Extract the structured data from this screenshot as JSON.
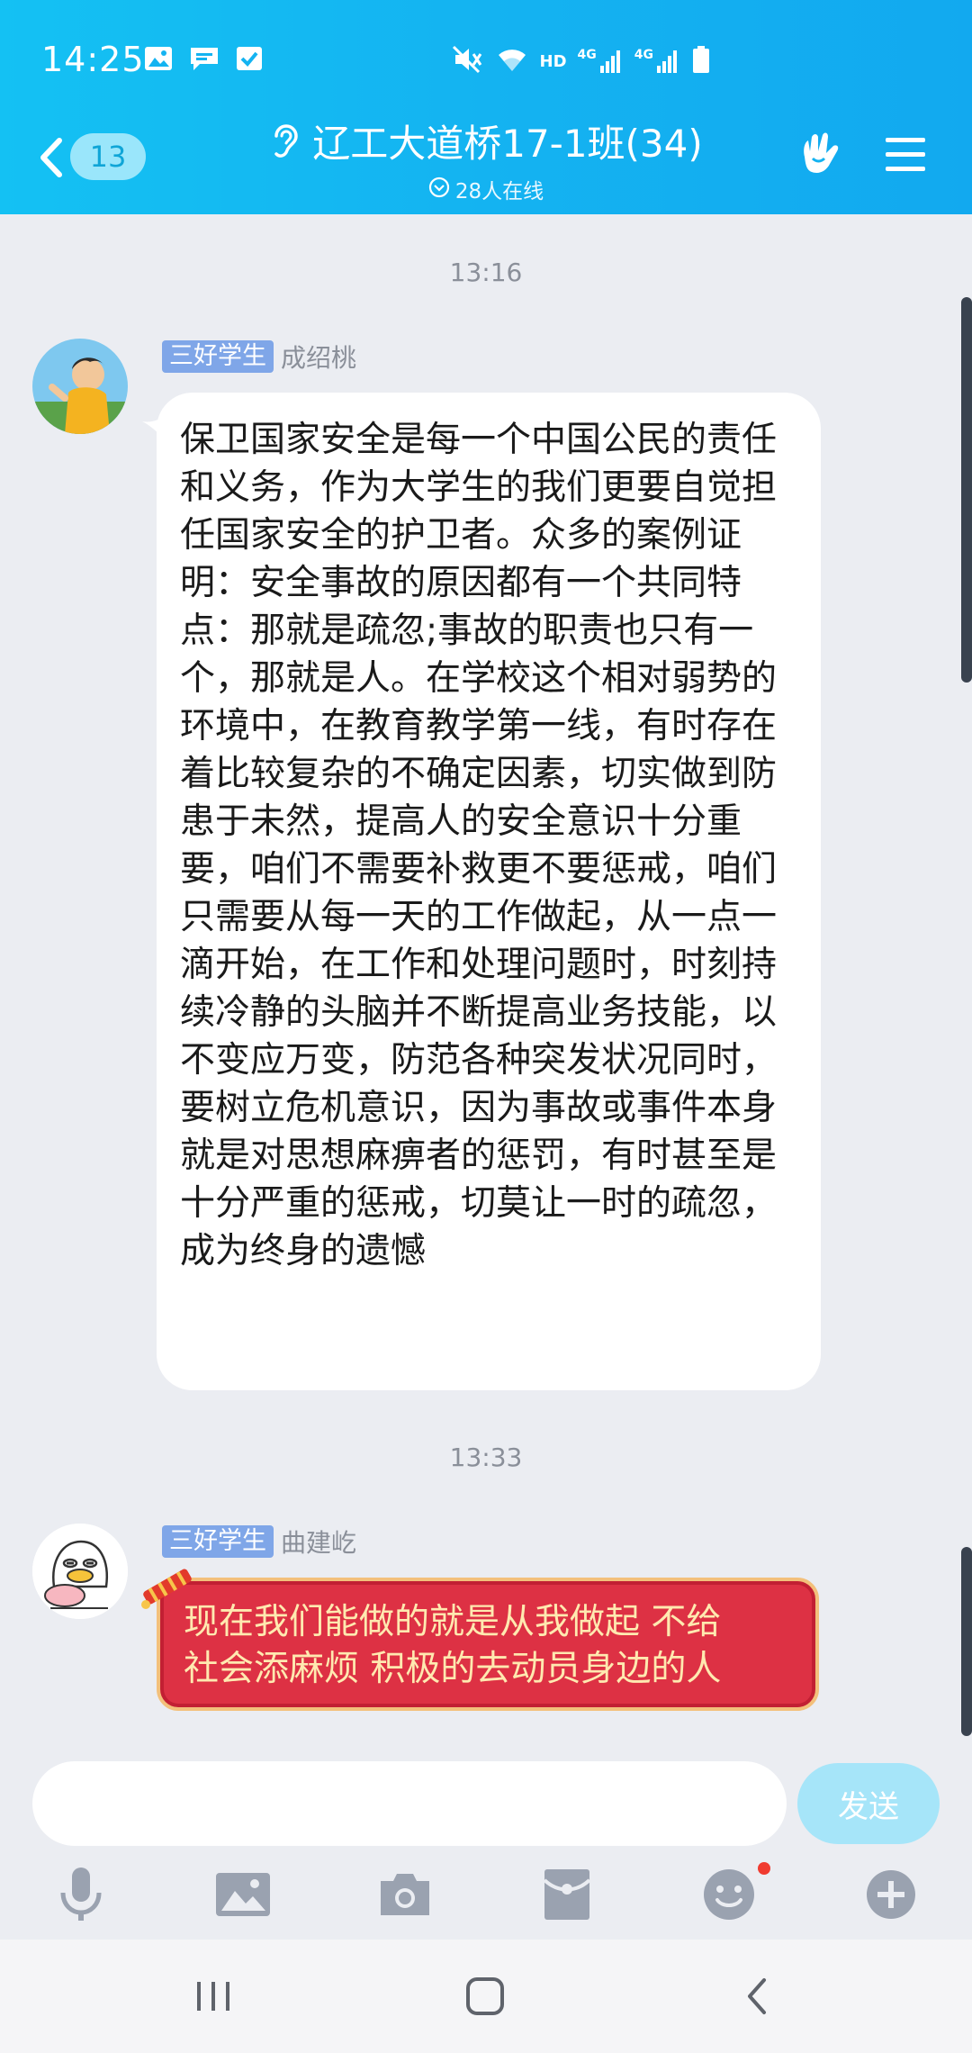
{
  "status_bar": {
    "time": "14:25",
    "hd_label": "HD",
    "net_label_1": "4G",
    "net_label_2": "4G"
  },
  "header": {
    "unread_count": "13",
    "title": "辽工大道桥17-1班(34)",
    "online_text": "28人在线"
  },
  "messages": [
    {
      "timestamp": "13:16",
      "badge": "三好学生",
      "sender": "成绍桃",
      "text": "保卫国家安全是每一个中国公民的责任和义务，作为大学生的我们更要自觉担任国家安全的护卫者。众多的案例证明：安全事故的原因都有一个共同特点：那就是疏忽;事故的职责也只有一个，那就是人。在学校这个相对弱势的环境中，在教育教学第一线，有时存在着比较复杂的不确定因素，切实做到防患于未然，提高人的安全意识十分重要，咱们不需要补救更不要惩戒，咱们只需要从每一天的工作做起，从一点一滴开始，在工作和处理问题时，时刻持续冷静的头脑并不断提高业务技能，以不变应万变，防范各种突发状况同时，要树立危机意识，因为事故或事件本身就是对思想麻痹者的惩罚，有时甚至是十分严重的惩戒，切莫让一时的疏忽，成为终身的遗憾"
    },
    {
      "timestamp": "13:33",
      "badge": "三好学生",
      "sender": "曲建屹",
      "text_line_1": "现在我们能做的就是从我做起  不给",
      "text_line_2": "社会添麻烦 积极的去动员身边的人"
    }
  ],
  "input": {
    "placeholder": "",
    "send_label": "发送"
  },
  "toolbar_icons": [
    "mic-icon",
    "image-icon",
    "camera-icon",
    "red-packet-icon",
    "emoji-icon",
    "plus-icon"
  ],
  "colors": {
    "header_blue": "#14b3f1",
    "badge_blue": "#7fa6e8",
    "red_bubble": "#dd3144",
    "send_button": "#a6e5f9"
  }
}
